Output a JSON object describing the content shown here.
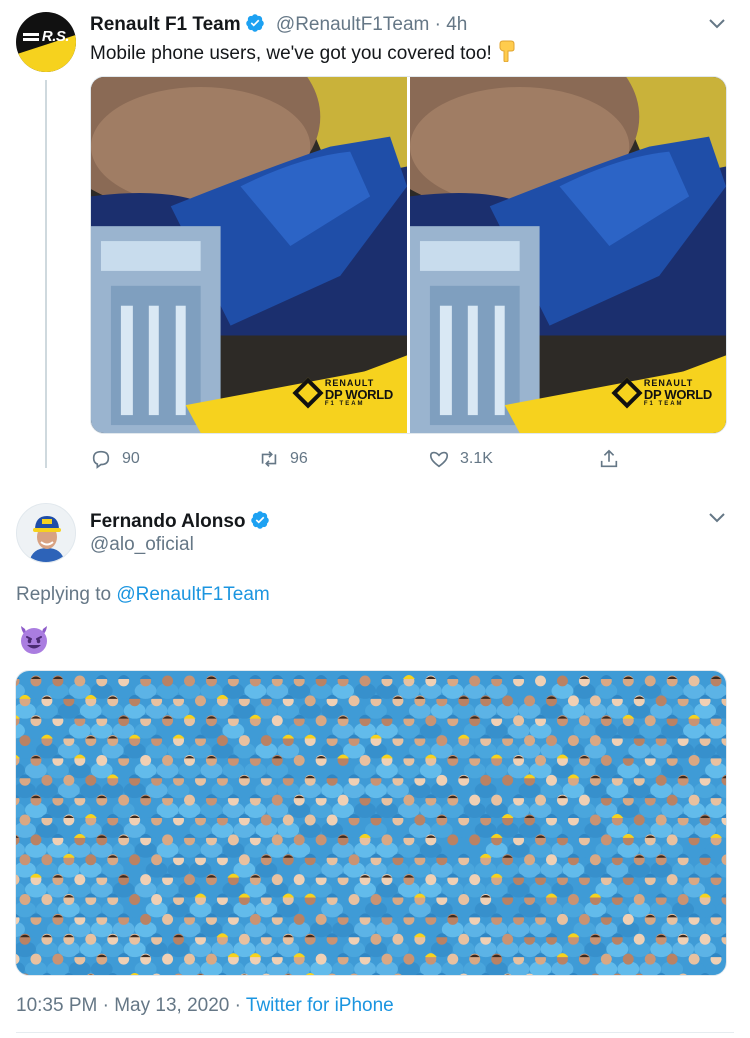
{
  "tweet1": {
    "display_name": "Renault F1 Team",
    "handle": "@RenaultF1Team",
    "separator": "·",
    "time": "4h",
    "text": "Mobile phone users, we've got you covered too!",
    "avatar_text": "R.S.",
    "media_logo": {
      "line1": "RENAULT",
      "line2": "DP WORLD",
      "line3": "F1 TEAM"
    },
    "stats": {
      "replies": "90",
      "retweets": "96",
      "likes": "3.1K"
    }
  },
  "tweet2": {
    "display_name": "Fernando Alonso",
    "handle": "@alo_oficial",
    "replying_prefix": "Replying to",
    "replying_to": "@RenaultF1Team",
    "emoji": "smiling-face-with-horns",
    "timestamp": "10:35 PM · May 13, 2020",
    "meta_sep": "·",
    "source": "Twitter for iPhone"
  },
  "colors": {
    "link": "#1b95e0",
    "muted": "#657786",
    "verified": "#1da1f2",
    "renault_yellow": "#f6d21e",
    "crowd_blue": "#4aa6dd"
  },
  "icons": [
    "verified-badge-icon",
    "chevron-down-icon",
    "pointing-down-hand-icon",
    "reply-icon",
    "retweet-icon",
    "like-icon",
    "share-icon"
  ]
}
